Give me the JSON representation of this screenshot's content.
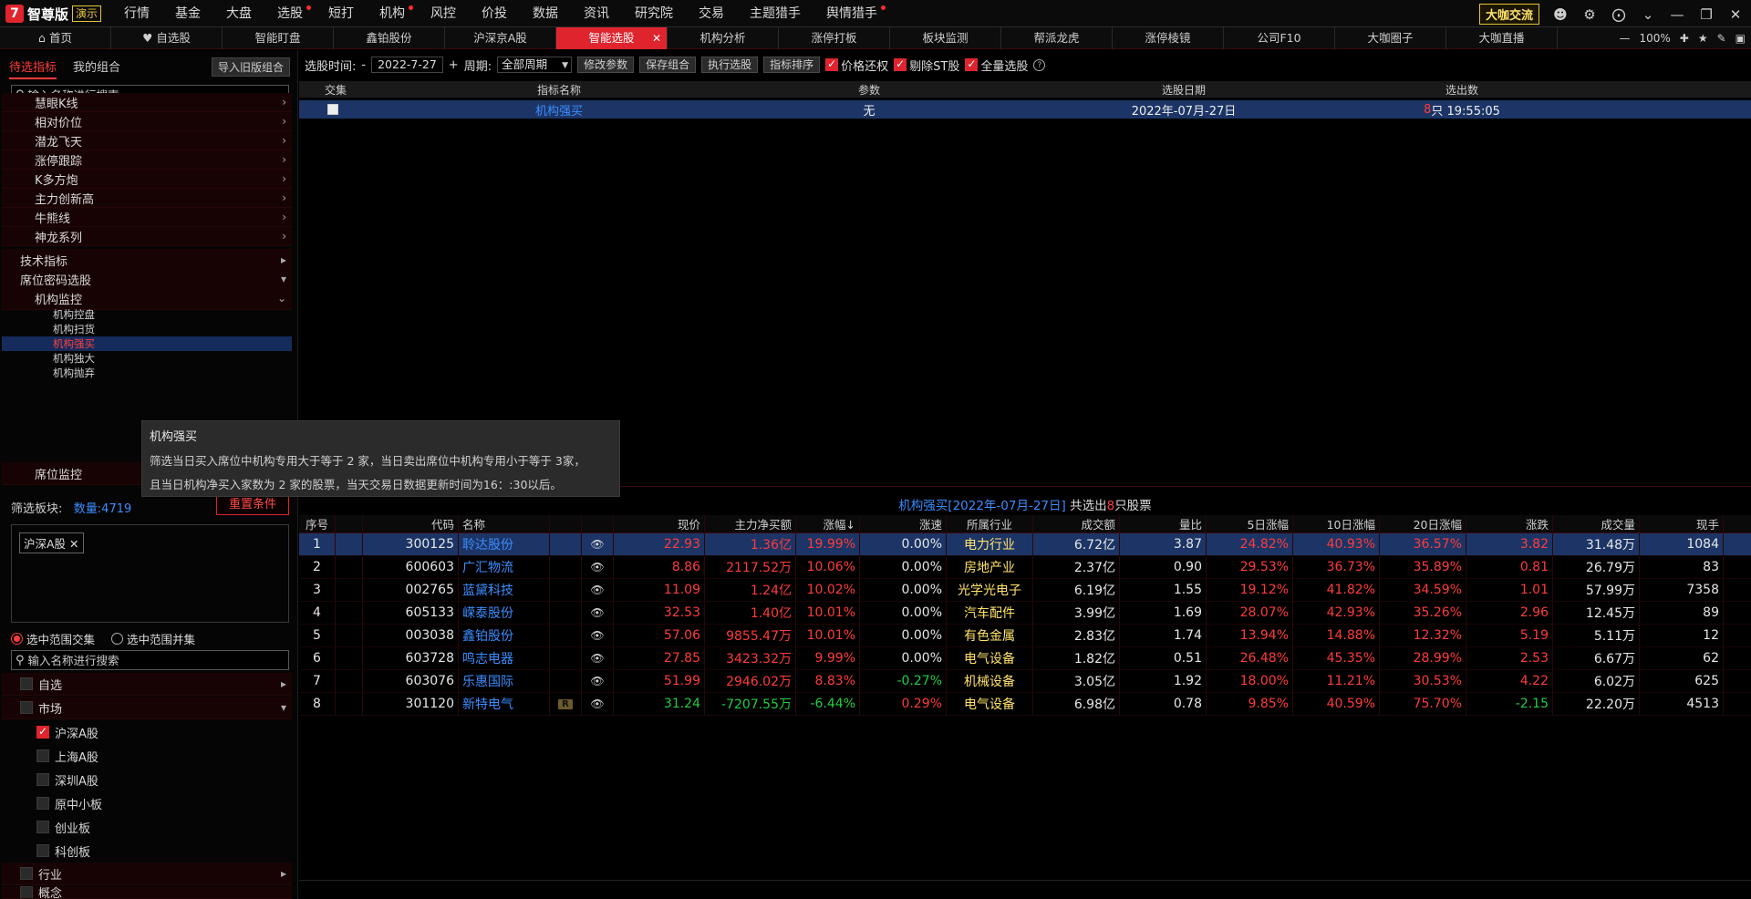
{
  "app": {
    "logo_name": "智尊版",
    "demo_badge": "演示",
    "menu": [
      {
        "label": "行情",
        "dot": false
      },
      {
        "label": "基金",
        "dot": false
      },
      {
        "label": "大盘",
        "dot": false
      },
      {
        "label": "选股",
        "dot": true
      },
      {
        "label": "短打",
        "dot": false
      },
      {
        "label": "机构",
        "dot": true
      },
      {
        "label": "风控",
        "dot": false
      },
      {
        "label": "价投",
        "dot": false
      },
      {
        "label": "数据",
        "dot": false
      },
      {
        "label": "资讯",
        "dot": false
      },
      {
        "label": "研究院",
        "dot": false
      },
      {
        "label": "交易",
        "dot": false
      },
      {
        "label": "主题猎手",
        "dot": false
      },
      {
        "label": "舆情猎手",
        "dot": true
      }
    ],
    "big_cafe_button": "大咖交流",
    "zoom": "100%"
  },
  "tabs": [
    {
      "label": "首页",
      "icon": "home-icon",
      "active": false
    },
    {
      "label": "自选股",
      "icon": "heart-icon",
      "active": false
    },
    {
      "label": "智能盯盘",
      "active": false
    },
    {
      "label": "鑫铂股份",
      "active": false
    },
    {
      "label": "沪深京A股",
      "active": false
    },
    {
      "label": "智能选股",
      "active": true
    },
    {
      "label": "机构分析",
      "active": false
    },
    {
      "label": "涨停打板",
      "active": false
    },
    {
      "label": "板块监测",
      "active": false
    },
    {
      "label": "帮派龙虎",
      "active": false
    },
    {
      "label": "涨停棱镜",
      "active": false
    },
    {
      "label": "公司F10",
      "active": false
    },
    {
      "label": "大咖圈子",
      "active": false
    },
    {
      "label": "大咖直播",
      "active": false
    }
  ],
  "left": {
    "tabs": [
      "待选指标",
      "我的组合"
    ],
    "import_button": "导入旧版组合",
    "search_placeholder": "输入名称进行搜索",
    "indicator_groups": [
      "慧眼K线",
      "相对价位",
      "潜龙飞天",
      "涨停跟踪",
      "K多方炮",
      "主力创新高",
      "牛熊线",
      "神龙系列"
    ],
    "tech_indicator": "技术指标",
    "seat_code": "席位密码选股",
    "inst_monitor": "机构监控",
    "inst_items": [
      "机构控盘",
      "机构扫货",
      "机构强买",
      "机构独大",
      "机构抛弃"
    ],
    "seat_monitor": "席位监控",
    "filter_label": "筛选板块:",
    "count_text": "数量:4719",
    "reset_button": "重置条件",
    "chip": "沪深A股",
    "radio_intersect": "选中范围交集",
    "radio_union": "选中范围并集",
    "search2_placeholder": "输入名称进行搜索",
    "tree2_self": "自选",
    "tree2_market": "市场",
    "markets": [
      {
        "label": "沪深A股",
        "checked": true
      },
      {
        "label": "上海A股",
        "checked": false
      },
      {
        "label": "深圳A股",
        "checked": false
      },
      {
        "label": "原中小板",
        "checked": false
      },
      {
        "label": "创业板",
        "checked": false
      },
      {
        "label": "科创板",
        "checked": false
      }
    ],
    "tree2_industry": "行业",
    "tree2_concept": "概念"
  },
  "tooltip": {
    "title": "机构强买",
    "line1": "筛选当日买入席位中机构专用大于等于 2 家，当日卖出席位中机构专用小于等于 3家，",
    "line2": "且当日机构净买入家数为 2 家的股票，当天交易日数据更新时间为16：:30以后。"
  },
  "toolbar": {
    "time_label": "选股时间:",
    "minus": "-",
    "date": "2022-7-27",
    "plus": "+",
    "period_label": "周期:",
    "period_value": "全部周期",
    "btn_modify": "修改参数",
    "btn_save": "保存组合",
    "btn_exec": "执行选股",
    "btn_sort": "指标排序",
    "chk_price": "价格还权",
    "chk_st": "剔除ST股",
    "chk_all": "全量选股"
  },
  "indicator_table": {
    "headers": [
      "交集",
      "指标名称",
      "参数",
      "选股日期",
      "选出数"
    ],
    "row": {
      "name": "机构强买",
      "param": "无",
      "date": "2022年-07月-27日",
      "count_num": "8",
      "count_rest": "只 19:55:05"
    }
  },
  "result": {
    "title_blue": "机构强买[2022年-07月-27日]",
    "title_mid": " 共选出",
    "title_num": "8",
    "title_end": "只股票",
    "headers": [
      "序号",
      "",
      "代码",
      "名称",
      "",
      "",
      "现价",
      "主力净买额",
      "涨幅↓",
      "涨速",
      "所属行业",
      "成交额",
      "量比",
      "5日涨幅",
      "10日涨幅",
      "20日涨幅",
      "涨跌",
      "成交量",
      "现手"
    ],
    "rows": [
      {
        "no": "1",
        "code": "300125",
        "name": "聆达股份",
        "r": "",
        "price": "22.93",
        "net": "1.36亿",
        "chg": "19.99%",
        "speed": "0.00%",
        "ind": "电力行业",
        "amt": "6.72亿",
        "vr": "3.87",
        "d5": "24.82%",
        "d10": "40.93%",
        "d20": "36.57%",
        "diff": "3.82",
        "vol": "31.48万",
        "hand": "1084",
        "dir": "up",
        "speed_dir": "wh",
        "net_dir": "up",
        "diff_dir": "up"
      },
      {
        "no": "2",
        "code": "600603",
        "name": "广汇物流",
        "r": "",
        "price": "8.86",
        "net": "2117.52万",
        "chg": "10.06%",
        "speed": "0.00%",
        "ind": "房地产业",
        "amt": "2.37亿",
        "vr": "0.90",
        "d5": "29.53%",
        "d10": "36.73%",
        "d20": "35.89%",
        "diff": "0.81",
        "vol": "26.79万",
        "hand": "83",
        "dir": "up",
        "speed_dir": "wh",
        "net_dir": "up",
        "diff_dir": "up"
      },
      {
        "no": "3",
        "code": "002765",
        "name": "蓝黛科技",
        "r": "",
        "price": "11.09",
        "net": "1.24亿",
        "chg": "10.02%",
        "speed": "0.00%",
        "ind": "光学光电子",
        "amt": "6.19亿",
        "vr": "1.55",
        "d5": "19.12%",
        "d10": "41.82%",
        "d20": "34.59%",
        "diff": "1.01",
        "vol": "57.99万",
        "hand": "7358",
        "dir": "up",
        "speed_dir": "wh",
        "net_dir": "up",
        "diff_dir": "up"
      },
      {
        "no": "4",
        "code": "605133",
        "name": "嵘泰股份",
        "r": "",
        "price": "32.53",
        "net": "1.40亿",
        "chg": "10.01%",
        "speed": "0.00%",
        "ind": "汽车配件",
        "amt": "3.99亿",
        "vr": "1.69",
        "d5": "28.07%",
        "d10": "42.93%",
        "d20": "35.26%",
        "diff": "2.96",
        "vol": "12.45万",
        "hand": "89",
        "dir": "up",
        "speed_dir": "wh",
        "net_dir": "up",
        "diff_dir": "up"
      },
      {
        "no": "5",
        "code": "003038",
        "name": "鑫铂股份",
        "r": "",
        "price": "57.06",
        "net": "9855.47万",
        "chg": "10.01%",
        "speed": "0.00%",
        "ind": "有色金属",
        "amt": "2.83亿",
        "vr": "1.74",
        "d5": "13.94%",
        "d10": "14.88%",
        "d20": "12.32%",
        "diff": "5.19",
        "vol": "5.11万",
        "hand": "12",
        "dir": "up",
        "speed_dir": "wh",
        "net_dir": "up",
        "diff_dir": "up"
      },
      {
        "no": "6",
        "code": "603728",
        "name": "鸣志电器",
        "r": "",
        "price": "27.85",
        "net": "3423.32万",
        "chg": "9.99%",
        "speed": "0.00%",
        "ind": "电气设备",
        "amt": "1.82亿",
        "vr": "0.51",
        "d5": "26.48%",
        "d10": "45.35%",
        "d20": "28.99%",
        "diff": "2.53",
        "vol": "6.67万",
        "hand": "62",
        "dir": "up",
        "speed_dir": "wh",
        "net_dir": "up",
        "diff_dir": "up"
      },
      {
        "no": "7",
        "code": "603076",
        "name": "乐惠国际",
        "r": "",
        "price": "51.99",
        "net": "2946.02万",
        "chg": "8.83%",
        "speed": "-0.27%",
        "ind": "机械设备",
        "amt": "3.05亿",
        "vr": "1.92",
        "d5": "18.00%",
        "d10": "11.21%",
        "d20": "30.53%",
        "diff": "4.22",
        "vol": "6.02万",
        "hand": "625",
        "dir": "up",
        "speed_dir": "dn",
        "net_dir": "up",
        "diff_dir": "up"
      },
      {
        "no": "8",
        "code": "301120",
        "name": "新特电气",
        "r": "R",
        "price": "31.24",
        "net": "-7207.55万",
        "chg": "-6.44%",
        "speed": "0.29%",
        "ind": "电气设备",
        "amt": "6.98亿",
        "vr": "0.78",
        "d5": "9.85%",
        "d10": "40.59%",
        "d20": "75.70%",
        "diff": "-2.15",
        "vol": "22.20万",
        "hand": "4513",
        "dir": "dn",
        "speed_dir": "up",
        "net_dir": "dn",
        "diff_dir": "dn"
      }
    ]
  },
  "colors": {
    "accent": "#e0242d",
    "up": "#ff3b3b",
    "down": "#22cc44",
    "selected": "#1c3566",
    "link": "#3b8dff"
  }
}
